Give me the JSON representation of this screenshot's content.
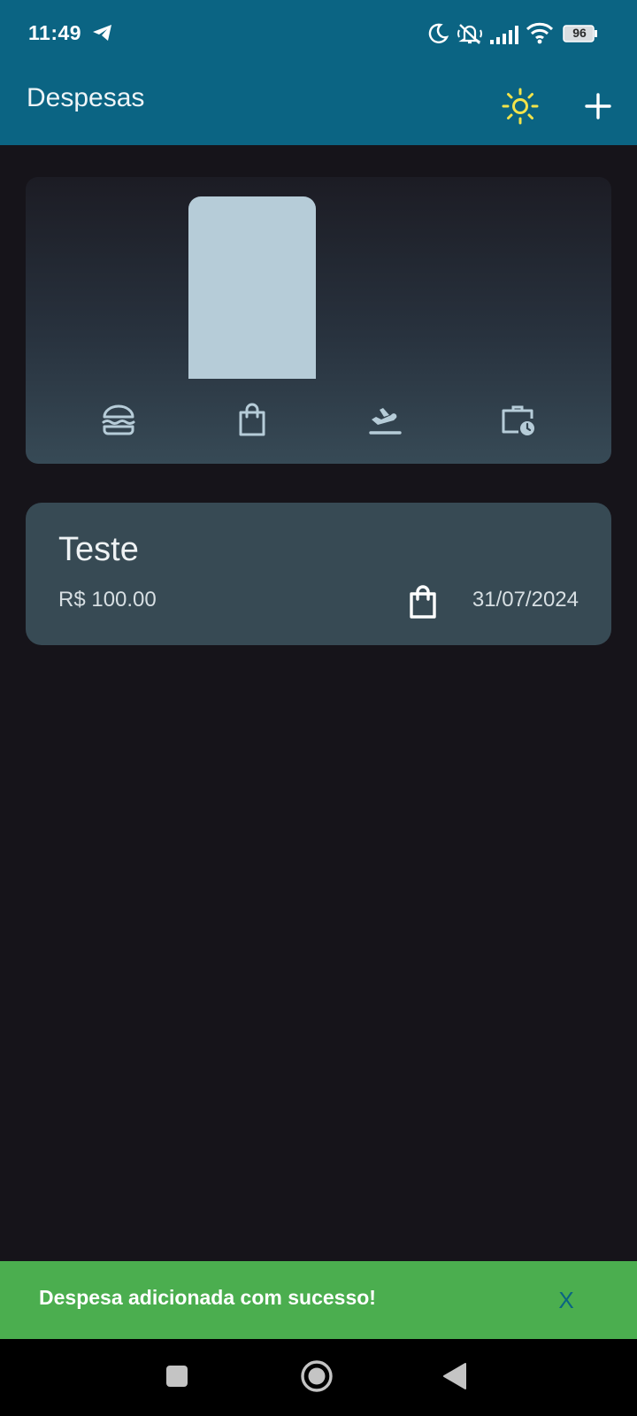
{
  "status_bar": {
    "time": "11:49",
    "battery": "96",
    "icons": [
      "telegram-icon",
      "moon-icon",
      "mute-icon",
      "signal-icon",
      "wifi-icon",
      "battery-icon"
    ]
  },
  "app_bar": {
    "title": "Despesas",
    "actions": [
      "sun-icon",
      "add-icon"
    ],
    "colors": {
      "background": "#0b6483",
      "sun": "#f2e34a"
    }
  },
  "chart_data": {
    "type": "bar",
    "categories": [
      "food",
      "shopping",
      "travel",
      "work"
    ],
    "category_icons": [
      "burger-icon",
      "shopping-bag-icon",
      "airplane-icon",
      "briefcase-clock-icon"
    ],
    "values": [
      0,
      100,
      0,
      0
    ],
    "ylim": [
      0,
      100
    ],
    "grid": false,
    "bar_color": "#b6ccd8"
  },
  "expenses": [
    {
      "title": "Teste",
      "amount": "R$ 100.00",
      "date": "31/07/2024",
      "category_icon": "shopping-bag-icon"
    }
  ],
  "snackbar": {
    "message": "Despesa adicionada com sucesso!",
    "close_label": "X",
    "background": "#4bae4f"
  },
  "nav_bar": {
    "buttons": [
      "recents-icon",
      "home-icon",
      "back-icon"
    ]
  }
}
